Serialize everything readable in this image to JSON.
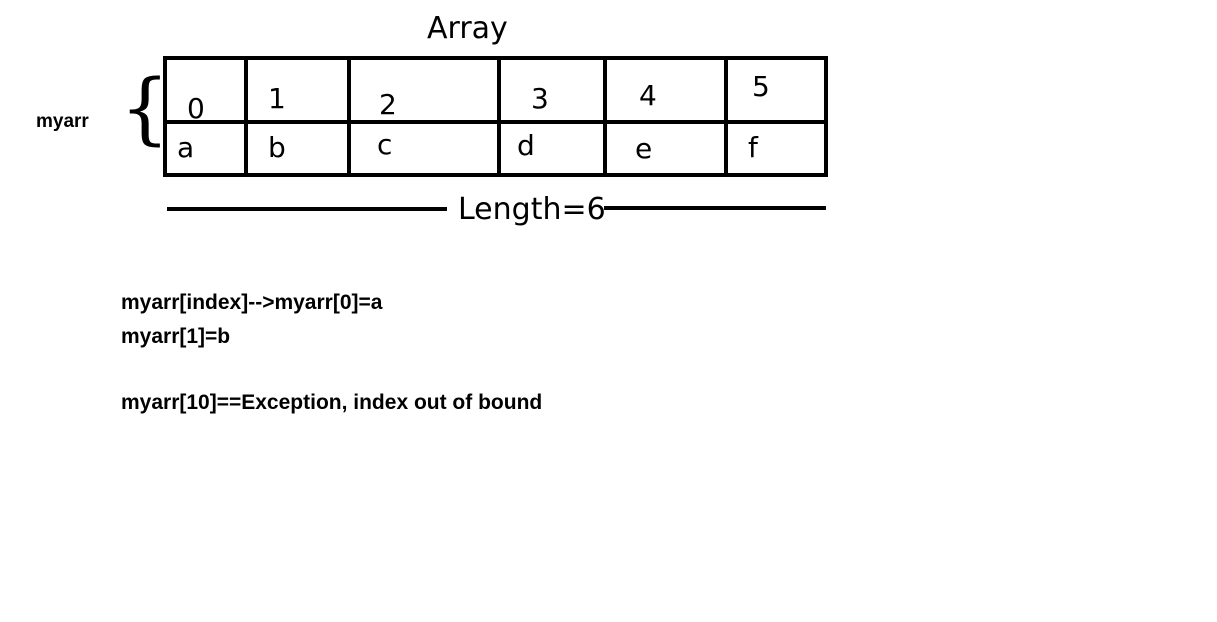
{
  "title": "Array",
  "variable_name": "myarr",
  "brace_glyph": "{",
  "cells": [
    {
      "index": "0",
      "value": "a"
    },
    {
      "index": "1",
      "value": "b"
    },
    {
      "index": "2",
      "value": "c"
    },
    {
      "index": "3",
      "value": "d"
    },
    {
      "index": "4",
      "value": "e"
    },
    {
      "index": "5",
      "value": "f"
    }
  ],
  "length_label": "Length=6",
  "notes": [
    "myarr[index]-->myarr[0]=a",
    "myarr[1]=b",
    "myarr[10]==Exception, index out of bound"
  ],
  "colors": {
    "ink": "#000000",
    "background": "#ffffff"
  }
}
